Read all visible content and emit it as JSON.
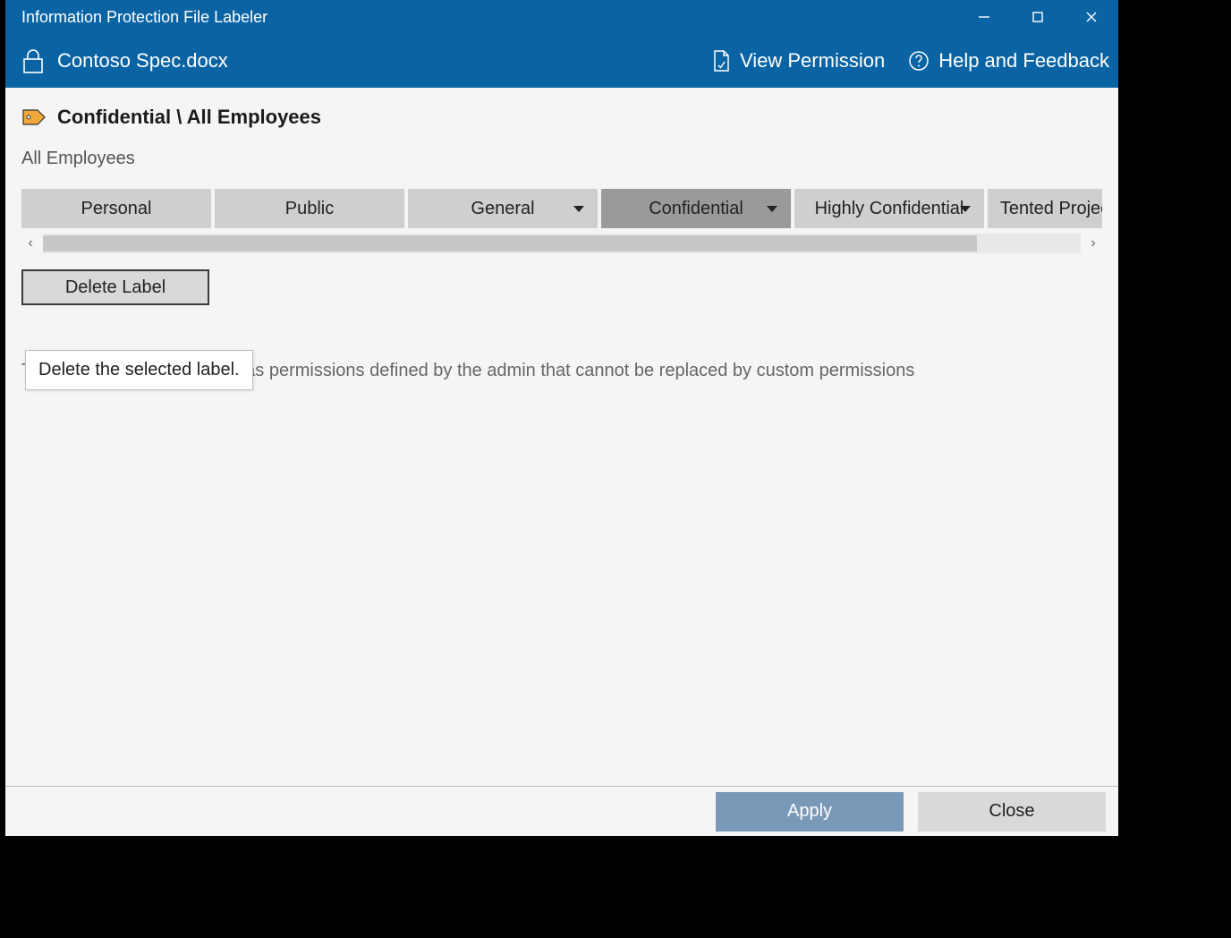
{
  "window": {
    "title": "Information Protection File Labeler"
  },
  "header": {
    "filename": "Contoso Spec.docx",
    "view_permission": "View Permission",
    "help_feedback": "Help and Feedback"
  },
  "current_label": {
    "path": "Confidential \\ All Employees",
    "sublabel": "All Employees"
  },
  "labels": [
    {
      "name": "Personal",
      "has_dropdown": false,
      "selected": false
    },
    {
      "name": "Public",
      "has_dropdown": false,
      "selected": false
    },
    {
      "name": "General",
      "has_dropdown": true,
      "selected": false
    },
    {
      "name": "Confidential",
      "has_dropdown": true,
      "selected": true
    },
    {
      "name": "Highly Confidential",
      "has_dropdown": true,
      "selected": false
    },
    {
      "name": "Tented Projec",
      "has_dropdown": false,
      "selected": false
    }
  ],
  "delete_label": "Delete Label",
  "tooltip": "Delete the selected label.",
  "info_text": "The selected label already has permissions defined by the admin that cannot be replaced by custom permissions",
  "footer": {
    "apply": "Apply",
    "close": "Close"
  }
}
